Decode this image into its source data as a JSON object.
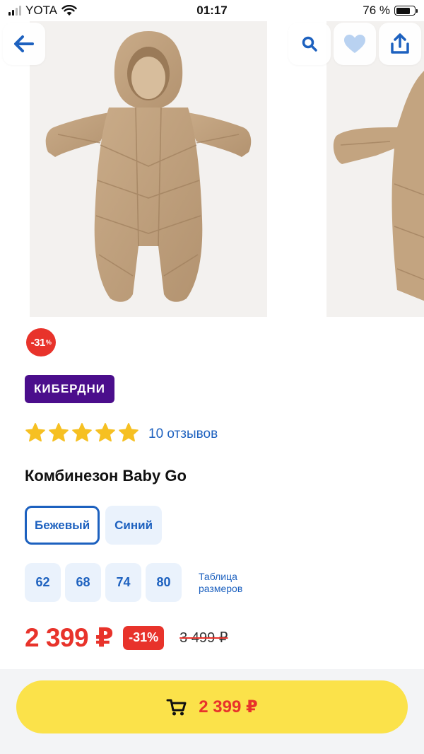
{
  "status_bar": {
    "carrier": "YOTA",
    "time": "01:17",
    "battery": "76 %",
    "battery_level": 0.76
  },
  "icons": {
    "back": "arrow-left-icon",
    "search": "search-icon",
    "favorite": "heart-icon",
    "share": "share-icon",
    "cart": "cart-icon",
    "star": "star-icon"
  },
  "colors": {
    "accent_blue": "#1d61bf",
    "sale_red": "#e8332b",
    "promo_purple": "#4b0e8c",
    "cta_yellow": "#fbe24a",
    "star_yellow": "#f6c022"
  },
  "product": {
    "discount_circle": "-31",
    "discount_circle_unit": "%",
    "promo_badge": "КИБЕРДНИ",
    "rating_stars": 5,
    "reviews": "10 отзывов",
    "title": "Комбинезон Baby Go",
    "color_options": [
      {
        "label": "Бежевый",
        "selected": true
      },
      {
        "label": "Синий",
        "selected": false
      }
    ],
    "sizes": [
      "62",
      "68",
      "74",
      "80"
    ],
    "size_table_link": "Таблица размеров",
    "price": "2 399 ₽",
    "price_discount": "-31%",
    "old_price": "3 499 ₽"
  },
  "cart_button": {
    "price": "2 399 ₽"
  }
}
